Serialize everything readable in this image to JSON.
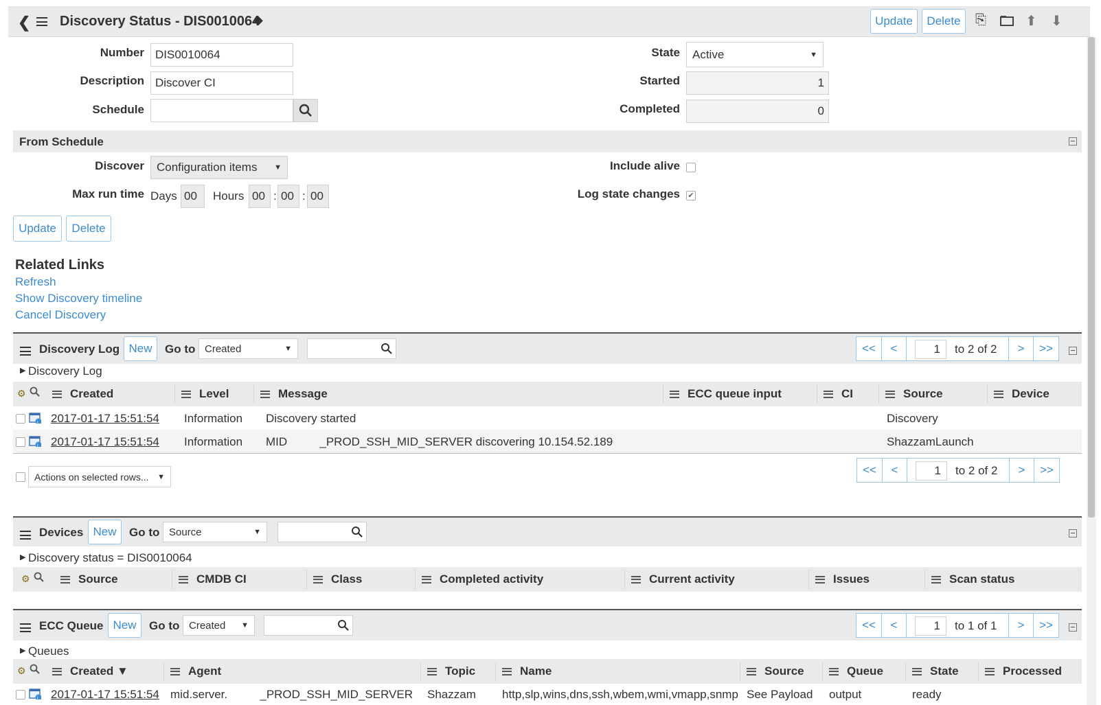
{
  "header": {
    "title": "Discovery Status - DIS0010064",
    "update_label": "Update",
    "delete_label": "Delete"
  },
  "form": {
    "number_label": "Number",
    "number_value": "DIS0010064",
    "description_label": "Description",
    "description_value": "Discover CI",
    "schedule_label": "Schedule",
    "schedule_value": "",
    "state_label": "State",
    "state_value": "Active",
    "started_label": "Started",
    "started_value": "1",
    "completed_label": "Completed",
    "completed_value": "0"
  },
  "from_schedule": {
    "title": "From Schedule",
    "discover_label": "Discover",
    "discover_value": "Configuration items",
    "max_run_label": "Max run time",
    "days_label": "Days",
    "days_value": "00",
    "hours_label": "Hours",
    "hours_value": "00",
    "minutes_value": "00",
    "seconds_value": "00",
    "include_alive_label": "Include alive",
    "include_alive_checked": false,
    "log_state_label": "Log state changes",
    "log_state_checked": true
  },
  "form_buttons": {
    "update": "Update",
    "delete": "Delete"
  },
  "related_links": {
    "title": "Related Links",
    "items": [
      "Refresh",
      "Show Discovery timeline",
      "Cancel Discovery"
    ]
  },
  "discovery_log": {
    "title": "Discovery Log",
    "new_label": "New",
    "goto_label": "Go to",
    "goto_value": "Created",
    "breadcrumb": "Discovery Log",
    "pager": {
      "first": "<<",
      "prev": "<",
      "page": "1",
      "range": "to 2 of 2",
      "next": ">",
      "last": ">>"
    },
    "columns": [
      "Created",
      "Level",
      "Message",
      "ECC queue input",
      "CI",
      "Source",
      "Device"
    ],
    "rows": [
      {
        "created": "2017-01-17 15:51:54",
        "level": "Information",
        "message": "Discovery started",
        "ecc": "",
        "ci": "",
        "source": "Discovery",
        "device": ""
      },
      {
        "created": "2017-01-17 15:51:54",
        "level": "Information",
        "message": "MID          _PROD_SSH_MID_SERVER discovering 10.154.52.189",
        "ecc": "",
        "ci": "",
        "source": "ShazzamLaunch",
        "device": ""
      }
    ],
    "actions_label": "Actions on selected rows..."
  },
  "devices": {
    "title": "Devices",
    "new_label": "New",
    "goto_label": "Go to",
    "goto_value": "Source",
    "breadcrumb": "Discovery status = DIS0010064",
    "columns": [
      "Source",
      "CMDB CI",
      "Class",
      "Completed activity",
      "Current activity",
      "Issues",
      "Scan status"
    ]
  },
  "ecc_queue": {
    "title": "ECC Queue",
    "new_label": "New",
    "goto_label": "Go to",
    "goto_value": "Created",
    "breadcrumb": "Queues",
    "pager": {
      "first": "<<",
      "prev": "<",
      "page": "1",
      "range": "to 1 of 1",
      "next": ">",
      "last": ">>"
    },
    "columns": [
      "Created ▼",
      "Agent",
      "Topic",
      "Name",
      "Source",
      "Queue",
      "State",
      "Processed"
    ],
    "rows": [
      {
        "created": "2017-01-17 15:51:54",
        "agent": "mid.server.          _PROD_SSH_MID_SERVER",
        "topic": "Shazzam",
        "name": "http,slp,wins,dns,ssh,wbem,wmi,vmapp,snmp",
        "source": "See Payload",
        "queue": "output",
        "state": "ready",
        "processed": ""
      }
    ]
  },
  "colors": {
    "accent": "#3b8bd1",
    "band": "#e9eaeb",
    "border": "#9cc7e8"
  }
}
